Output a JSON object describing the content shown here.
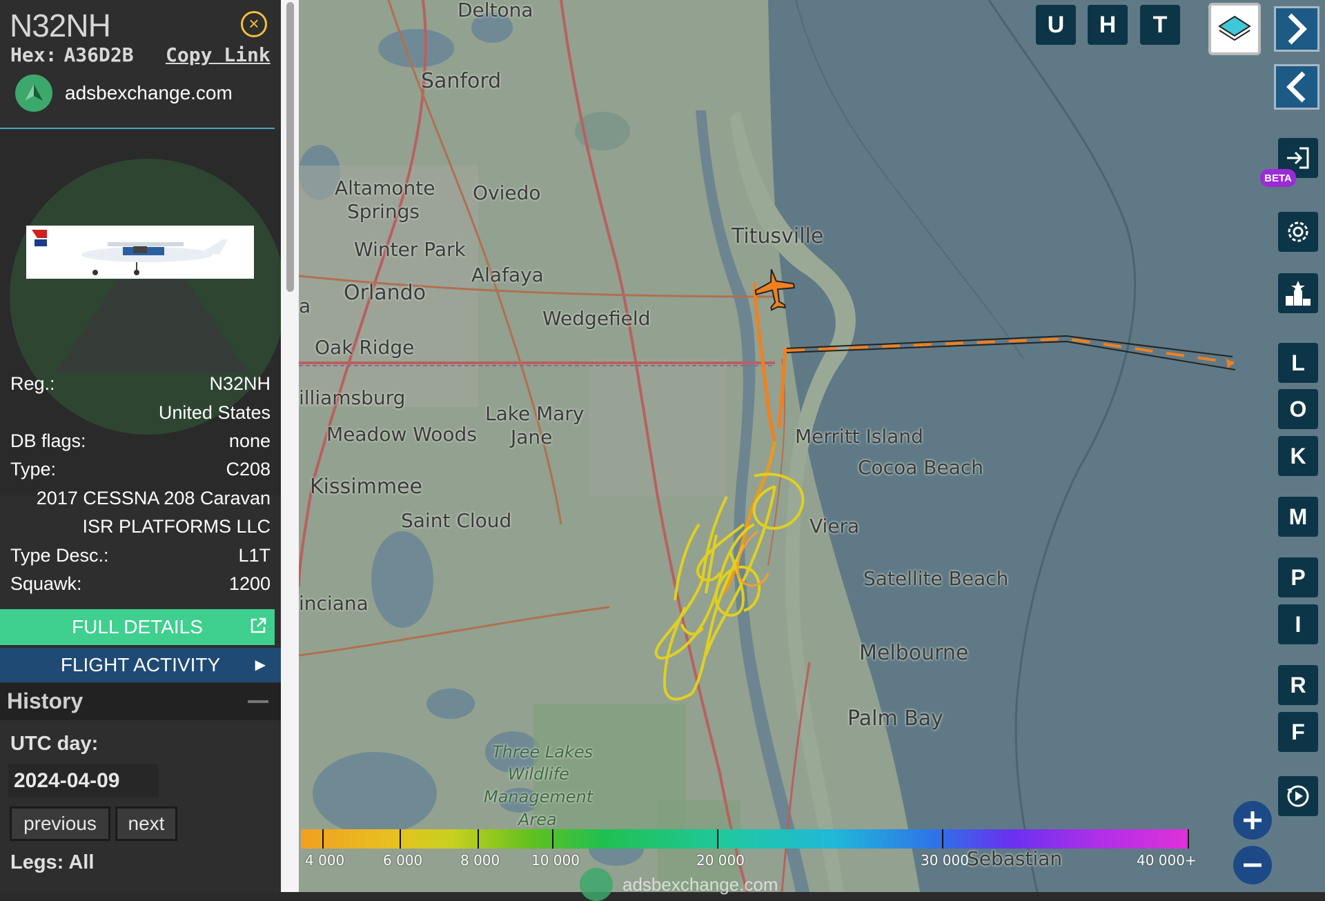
{
  "sidebar": {
    "callsign": "N32NH",
    "hex_label": "Hex:",
    "hex_value": "A36D2B",
    "copy_link": "Copy Link",
    "site": "adsbexchange.com",
    "info": {
      "reg_label": "Reg.:",
      "reg_value": "N32NH",
      "country": "United States",
      "dbflags_label": "DB flags:",
      "dbflags_value": "none",
      "type_label": "Type:",
      "type_value": "C208",
      "model": "2017 CESSNA 208 Caravan",
      "owner": "ISR PLATFORMS LLC",
      "typedesc_label": "Type Desc.:",
      "typedesc_value": "L1T",
      "squawk_label": "Squawk:",
      "squawk_value": "1200"
    },
    "full_details": "FULL DETAILS",
    "flight_activity": "FLIGHT ACTIVITY",
    "history": "History",
    "utc_day_label": "UTC day:",
    "utc_day_value": "2024-04-09",
    "previous": "previous",
    "next": "next",
    "legs_label": "Legs: All"
  },
  "map": {
    "labels": {
      "deltona": "Deltona",
      "sanford": "Sanford",
      "altamonte": "Altamonte",
      "springs": "Springs",
      "oviedo": "Oviedo",
      "winter_park": "Winter Park",
      "alafaya": "Alafaya",
      "orlando": "Orlando",
      "wedgefield": "Wedgefield",
      "oak_ridge": "Oak Ridge",
      "titusville": "Titusville",
      "williamsburg": "illiamsburg",
      "lake_mary": "Lake Mary",
      "jane": "Jane",
      "meadow_woods": "Meadow Woods",
      "merritt_island": "Merritt Island",
      "cocoa_beach": "Cocoa Beach",
      "kissimmee": "Kissimmee",
      "saint_cloud": "Saint Cloud",
      "viera": "Viera",
      "satellite_beach": "Satellite Beach",
      "poinciana": "inciana",
      "melbourne": "Melbourne",
      "palm_bay": "Palm Bay",
      "three_lakes_1": "Three Lakes",
      "three_lakes_2": "Wildlife",
      "three_lakes_3": "Management",
      "three_lakes_4": "Area",
      "sebastian": "Sebastian",
      "left_edge": "a"
    },
    "top_buttons": [
      "U",
      "H",
      "T"
    ],
    "right_buttons": [
      "L",
      "O",
      "K",
      "M",
      "P",
      "I",
      "R",
      "F"
    ],
    "beta": "BETA",
    "altitude_legend": [
      "4 000",
      "6 000",
      "8 000",
      "10 000",
      "20 000",
      "30 000",
      "40 000+"
    ],
    "watermark": "adsbexchange.com"
  },
  "colors": {
    "accent_green": "#3fcf8e",
    "flight_blue": "#1f4a73",
    "button_navy": "#0d3548",
    "track_orange": "#f08020",
    "track_yellow": "#e0d020"
  }
}
